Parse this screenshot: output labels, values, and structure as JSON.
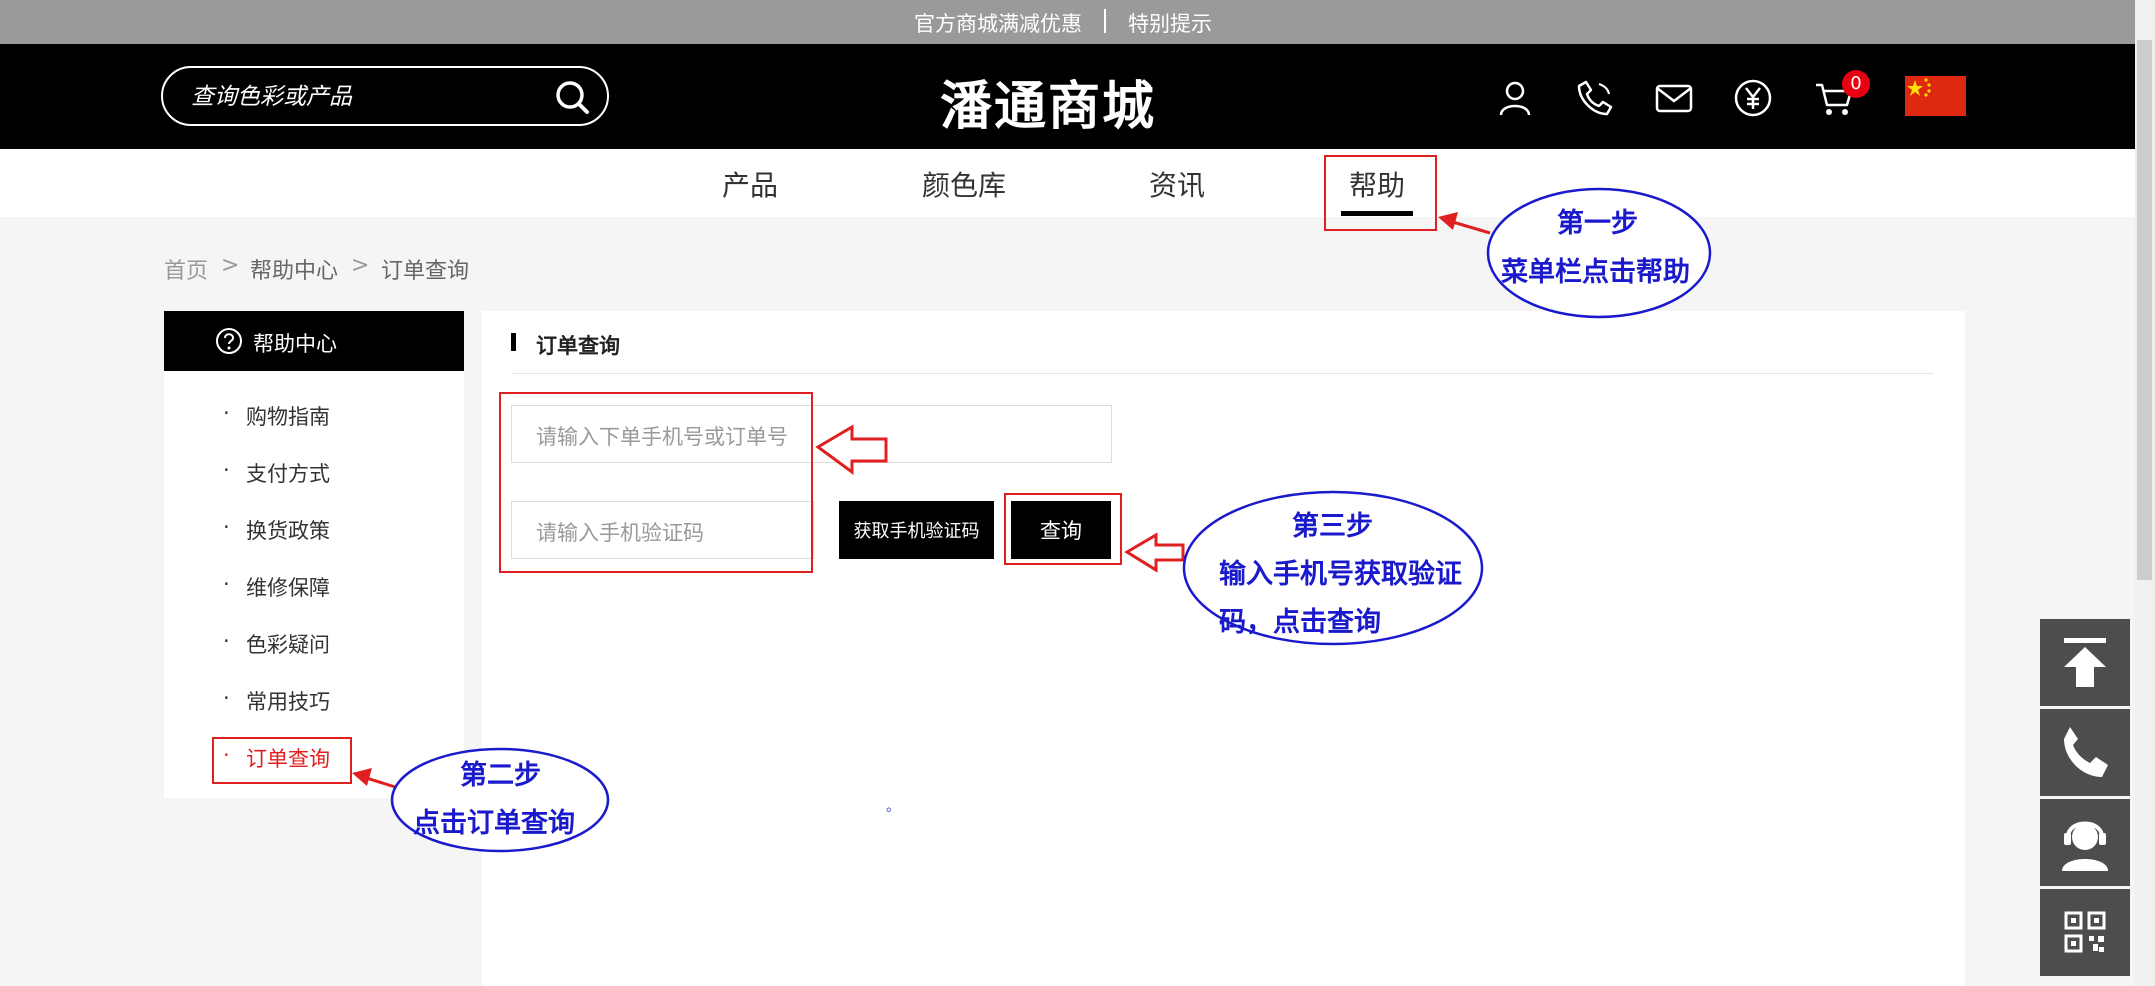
{
  "topbar": {
    "link1": "官方商城满减优惠",
    "link2": "特别提示"
  },
  "header": {
    "search_placeholder": "查询色彩或产品",
    "logo": "潘通商城",
    "cart_count": "0"
  },
  "nav": {
    "items": [
      "产品",
      "颜色库",
      "资讯",
      "帮助"
    ],
    "active": "帮助"
  },
  "breadcrumb": {
    "home": "首页",
    "sep": ">",
    "level2": "帮助中心",
    "level3": "订单查询"
  },
  "sidebar": {
    "title": "帮助中心",
    "items": [
      "购物指南",
      "支付方式",
      "换货政策",
      "维修保障",
      "色彩疑问",
      "常用技巧",
      "订单查询"
    ],
    "bullet": "·"
  },
  "main": {
    "title": "订单查询",
    "phone_placeholder": "请输入下单手机号或订单号",
    "code_placeholder": "请输入手机验证码",
    "get_code_label": "获取手机验证码",
    "query_label": "查询",
    "dot": "。"
  },
  "annotations": {
    "step1": {
      "line1": "第一步",
      "line2": "菜单栏点击帮助"
    },
    "step2": {
      "line1": "第二步",
      "line2": "点击订单查询"
    },
    "step3": {
      "line1": "第三步",
      "line2": "输入手机号获取验证",
      "line3": "码，点击查询"
    }
  },
  "colors": {
    "accent_red": "#e02020",
    "annotation_blue": "#1a1acc",
    "header_black": "#000000"
  }
}
